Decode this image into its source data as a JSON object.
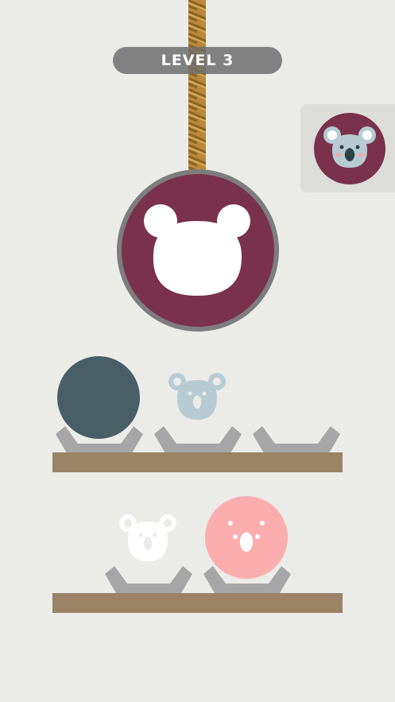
{
  "level": {
    "label": "LEVEL 3"
  },
  "colors": {
    "background": "#ebebe8",
    "rope": "#b8893a",
    "disc_maroon": "#7a314b",
    "disc_rim": "#7d7d7d",
    "shelf": "#9a8366",
    "holder": "#a6a6a6",
    "ball_slate": "#485f66",
    "ball_pink": "#fcadad",
    "koala_light_blue": "#b7cbd3",
    "koala_white": "#ffffff"
  },
  "target": {
    "icon": "koala-face-icon"
  },
  "hanging_disc": {
    "icon": "bear-head-silhouette-icon"
  },
  "shelves": [
    {
      "slots": [
        {
          "item": "slate-ball"
        },
        {
          "item": "light-blue-koala"
        },
        {
          "item": "empty"
        }
      ]
    },
    {
      "slots": [
        {
          "item": "white-koala"
        },
        {
          "item": "pink-koala-ball"
        }
      ]
    }
  ]
}
